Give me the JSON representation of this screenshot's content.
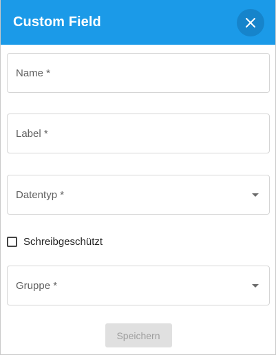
{
  "dialog": {
    "title": "Custom Field",
    "close_icon": "close-icon",
    "header_color": "#1b9ae8"
  },
  "form": {
    "name_label": "Name *",
    "label_label": "Label *",
    "datatype_label": "Datentyp *",
    "readonly_label": "Schreibgeschützt",
    "readonly_checked": false,
    "group_label": "Gruppe *",
    "dropdown_icon": "caret-down-icon"
  },
  "footer": {
    "save_label": "Speichern",
    "save_disabled": true
  }
}
